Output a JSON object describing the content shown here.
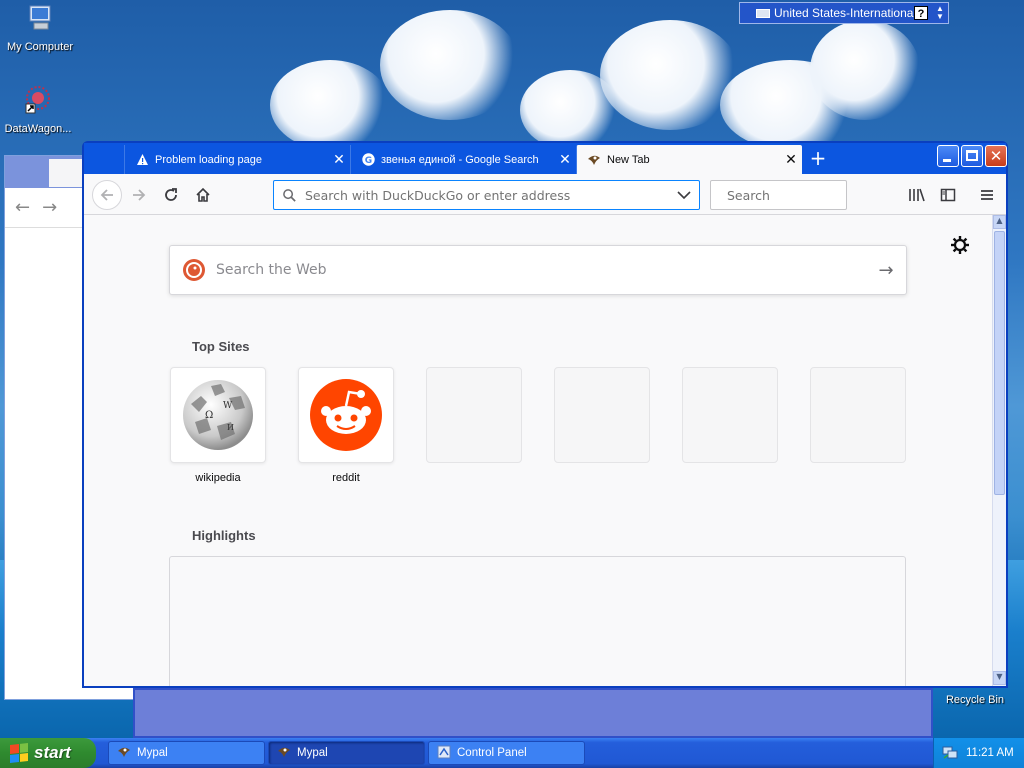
{
  "desktop": {
    "icons": [
      {
        "label": "My Computer"
      },
      {
        "label": "DataWagon..."
      },
      {
        "label": "Recycle Bin"
      }
    ],
    "language_bar": {
      "label": "United States-International",
      "help": "?"
    }
  },
  "browser": {
    "tabs": [
      {
        "title": "Problem loading page",
        "icon": "warning-icon"
      },
      {
        "title": "звенья единой - Google Search",
        "icon": "google-icon"
      },
      {
        "title": "New Tab",
        "icon": "mypal-icon",
        "active": true
      }
    ],
    "new_tab": "+",
    "urlbar": {
      "placeholder": "Search with DuckDuckGo or enter address"
    },
    "searchbar": {
      "placeholder": "Search"
    },
    "newtab_page": {
      "search_placeholder": "Search the Web",
      "top_sites_title": "Top Sites",
      "top_sites": [
        {
          "label": "wikipedia"
        },
        {
          "label": "reddit"
        },
        {
          "label": ""
        },
        {
          "label": ""
        },
        {
          "label": ""
        },
        {
          "label": ""
        }
      ],
      "highlights_title": "Highlights"
    }
  },
  "taskbar": {
    "start_label": "start",
    "tasks": [
      {
        "label": "Mypal"
      },
      {
        "label": "Mypal"
      },
      {
        "label": "Control Panel"
      }
    ],
    "clock": "11:21 AM"
  },
  "colors": {
    "accent": "#0a84ff",
    "xp_blue": "#245edb",
    "start_green": "#3c9a3c",
    "reddit_orange": "#ff4500"
  }
}
